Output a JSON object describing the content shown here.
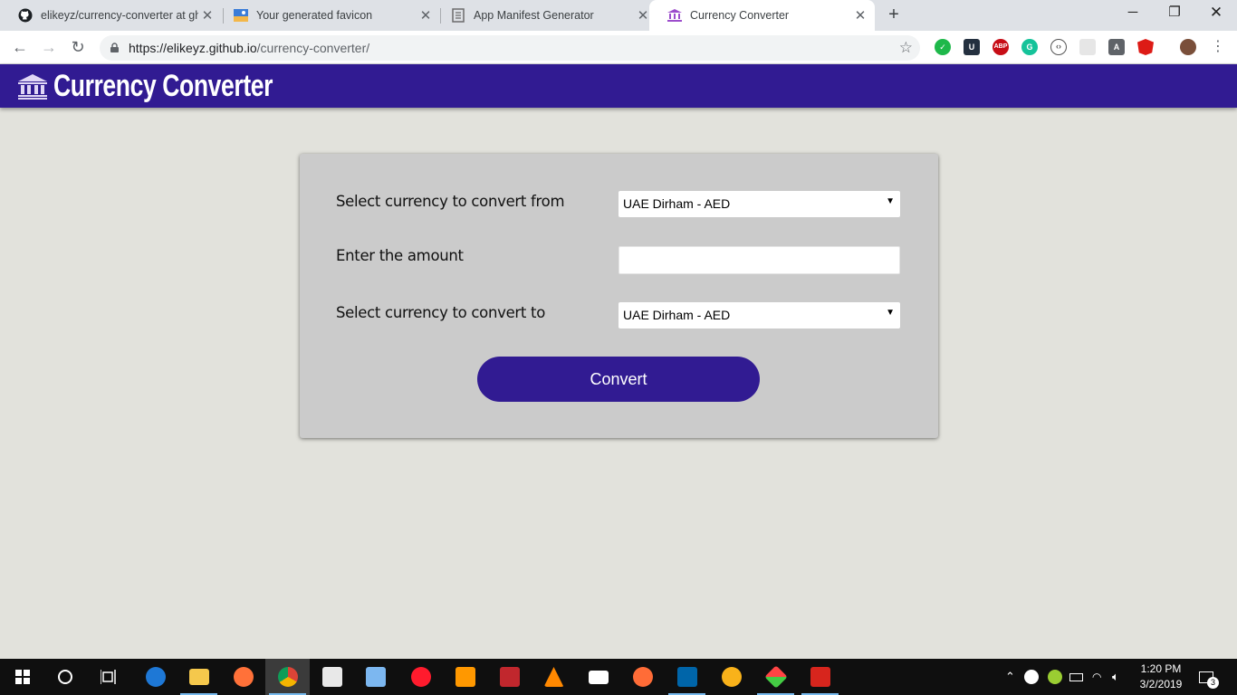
{
  "browser": {
    "tabs": [
      {
        "title": "elikeyz/currency-converter at gh-",
        "active": false
      },
      {
        "title": "Your generated favicon",
        "active": false
      },
      {
        "title": "App Manifest Generator",
        "active": false
      },
      {
        "title": "Currency Converter",
        "active": true
      }
    ],
    "url_host": "https://elikeyz.github.io",
    "url_path": "/currency-converter/",
    "extensions": [
      "check-icon",
      "u-icon",
      "adblock-icon",
      "grammarly-icon",
      "code-icon",
      "puzzle-icon",
      "a-icon",
      "angular-icon",
      "avatar"
    ],
    "ext_labels": {
      "abp": "ABP",
      "a": "A",
      "u": "U"
    }
  },
  "app": {
    "title": "Currency Converter",
    "header_color": "#311b92"
  },
  "form": {
    "from_label": "Select currency to convert from",
    "from_value": "UAE Dirham - AED",
    "amount_label": "Enter the amount",
    "amount_value": "",
    "to_label": "Select currency to convert to",
    "to_value": "UAE Dirham - AED",
    "convert_label": "Convert"
  },
  "taskbar": {
    "time": "1:20 PM",
    "date": "3/2/2019",
    "notifications": "3"
  }
}
